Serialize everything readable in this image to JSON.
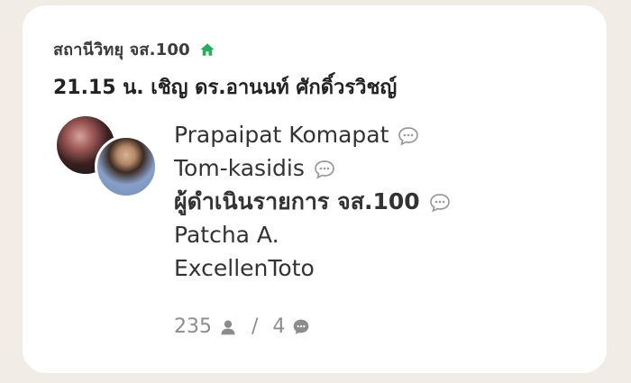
{
  "room": {
    "station_name": "สถานีวิทยุ จส.100",
    "title": "21.15 น. เชิญ ดร.อานนท์ ศักดิ์วรวิชญ์"
  },
  "members": [
    {
      "name": "Prapaipat Komapat",
      "speaking_icon": "chat-bubble-icon"
    },
    {
      "name": "Tom-kasidis",
      "speaking_icon": "chat-bubble-icon"
    },
    {
      "name": "ผู้ดำเนินรายการ จส.100",
      "speaking_icon": "chat-bubble-icon"
    },
    {
      "name": "Patcha A."
    },
    {
      "name": "ExcellenToto"
    }
  ],
  "stats": {
    "listeners": "235",
    "separator": "/",
    "speakers": "4"
  },
  "colors": {
    "background": "#f1ece6",
    "card": "#ffffff",
    "home_icon": "#27ae60",
    "stat_text": "#8c8c8c"
  }
}
